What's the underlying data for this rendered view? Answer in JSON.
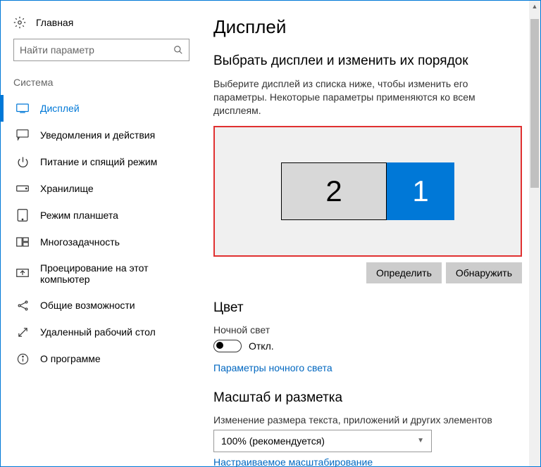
{
  "sidebar": {
    "home": "Главная",
    "search_placeholder": "Найти параметр",
    "section": "Система",
    "items": [
      {
        "label": "Дисплей"
      },
      {
        "label": "Уведомления и действия"
      },
      {
        "label": "Питание и спящий режим"
      },
      {
        "label": "Хранилище"
      },
      {
        "label": "Режим планшета"
      },
      {
        "label": "Многозадачность"
      },
      {
        "label": "Проецирование на этот компьютер"
      },
      {
        "label": "Общие возможности"
      },
      {
        "label": "Удаленный рабочий стол"
      },
      {
        "label": "О программе"
      }
    ]
  },
  "main": {
    "title": "Дисплей",
    "select_section": {
      "heading": "Выбрать дисплеи и изменить их порядок",
      "desc": "Выберите дисплей из списка ниже, чтобы изменить его параметры. Некоторые параметры применяются ко всем дисплеям.",
      "monitor2": "2",
      "monitor1": "1",
      "identify": "Определить",
      "detect": "Обнаружить"
    },
    "color": {
      "heading": "Цвет",
      "night_light_label": "Ночной свет",
      "toggle_state": "Откл.",
      "link": "Параметры ночного света"
    },
    "scale": {
      "heading": "Масштаб и разметка",
      "desc": "Изменение размера текста, приложений и других элементов",
      "dropdown": "100% (рекомендуется)",
      "custom_link": "Настраиваемое масштабирование"
    }
  }
}
